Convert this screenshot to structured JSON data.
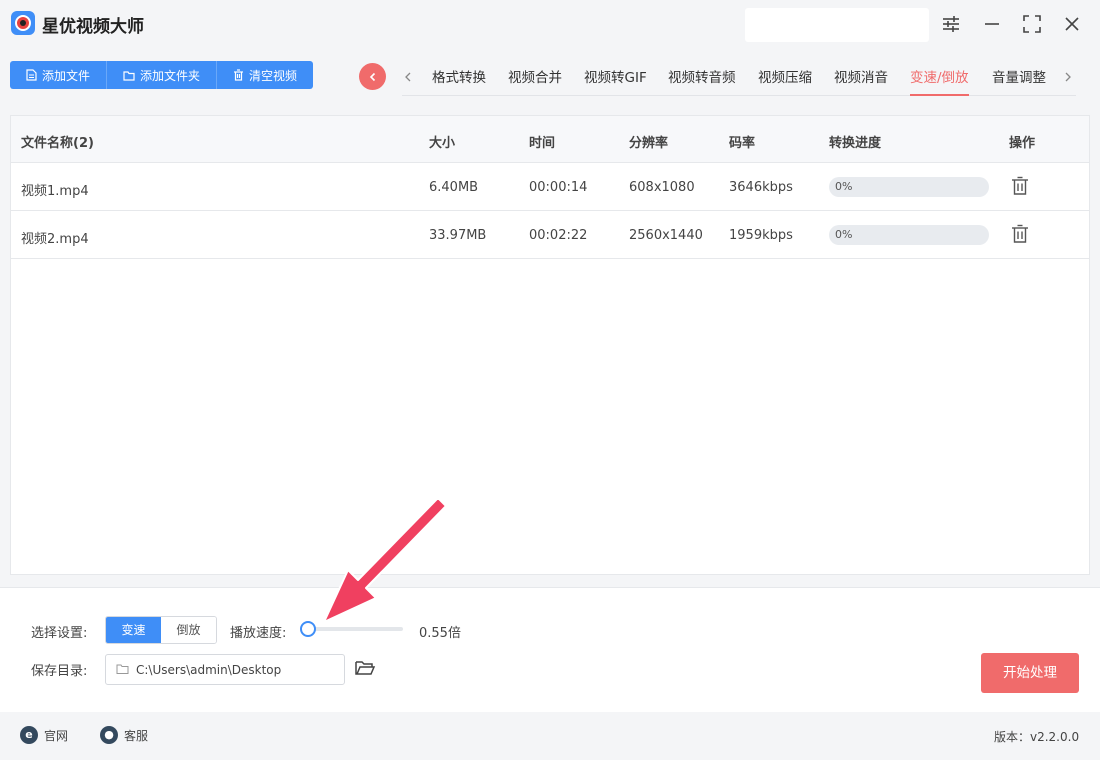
{
  "app": {
    "title": "星优视频大师"
  },
  "toolbar": {
    "add_file": "添加文件",
    "add_folder": "添加文件夹",
    "clear": "清空视频"
  },
  "tabs": [
    {
      "label": "格式转换"
    },
    {
      "label": "视频合并"
    },
    {
      "label": "视频转GIF"
    },
    {
      "label": "视频转音频"
    },
    {
      "label": "视频压缩"
    },
    {
      "label": "视频消音"
    },
    {
      "label": "变速/倒放",
      "active": true
    },
    {
      "label": "音量调整"
    }
  ],
  "table": {
    "headers": {
      "name": "文件名称(2)",
      "size": "大小",
      "time": "时间",
      "resolution": "分辨率",
      "bitrate": "码率",
      "progress": "转换进度",
      "action": "操作"
    },
    "rows": [
      {
        "name": "视频1.mp4",
        "size": "6.40MB",
        "time": "00:00:14",
        "resolution": "608x1080",
        "bitrate": "3646kbps",
        "progress": "0%",
        "progress_value": 0
      },
      {
        "name": "视频2.mp4",
        "size": "33.97MB",
        "time": "00:02:22",
        "resolution": "2560x1440",
        "bitrate": "1959kbps",
        "progress": "0%",
        "progress_value": 0
      }
    ]
  },
  "settings": {
    "mode_label": "选择设置:",
    "mode_options": [
      "变速",
      "倒放"
    ],
    "mode_selected": "变速",
    "speed_label": "播放速度:",
    "speed_value": "0.55倍",
    "save_label": "保存目录:",
    "save_path": "C:\\Users\\admin\\Desktop",
    "start_button": "开始处理"
  },
  "footer": {
    "website": "官网",
    "support": "客服",
    "version": "版本：v2.2.0.0"
  },
  "colors": {
    "primary": "#3f8ef7",
    "accent": "#f06b6b"
  },
  "icons": {
    "file": "file-icon",
    "folder": "folder-icon",
    "trash": "trash-icon",
    "settings": "sliders-icon",
    "minimize": "minimize-icon",
    "maximize": "maximize-icon",
    "close": "close-icon"
  }
}
